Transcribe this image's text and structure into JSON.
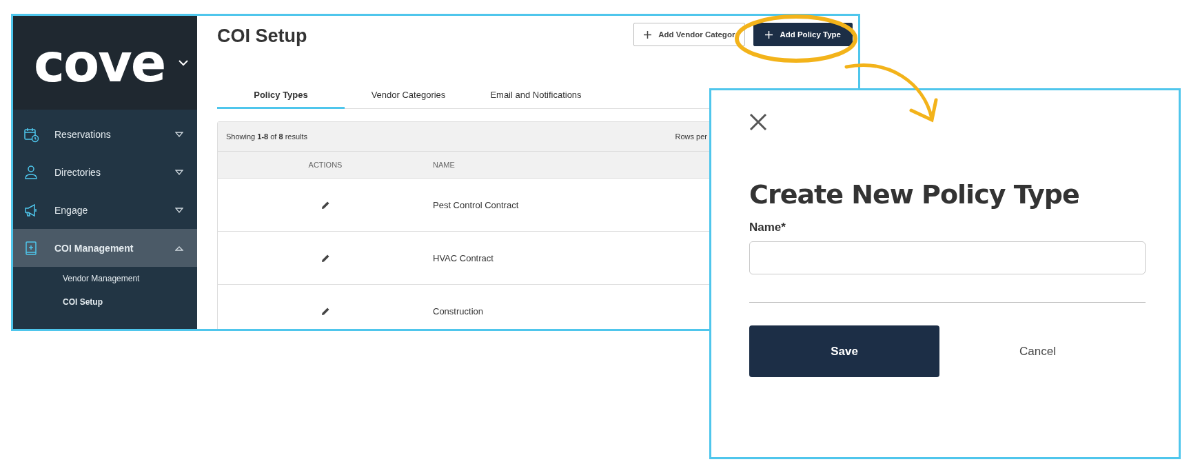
{
  "app_screen": {
    "logo": "cove",
    "sidebar": {
      "items": [
        {
          "kind": "calendar",
          "label": "Reservations",
          "expanded": false,
          "selected": false
        },
        {
          "kind": "person",
          "label": "Directories",
          "expanded": false,
          "selected": false
        },
        {
          "kind": "megaphone",
          "label": "Engage",
          "expanded": false,
          "selected": false
        },
        {
          "kind": "book",
          "label": "COI Management",
          "expanded": true,
          "selected": true,
          "children": [
            {
              "label": "Vendor Management",
              "selected": false
            },
            {
              "label": "COI Setup",
              "selected": true
            }
          ]
        }
      ]
    },
    "page_title": "COI Setup",
    "buttons": [
      {
        "label": "Add Vendor Categor",
        "primary": false
      },
      {
        "label": "Add Policy Type",
        "primary": true
      }
    ],
    "tabs": [
      {
        "label": "Policy Types",
        "selected": true
      },
      {
        "label": "Vendor Categories",
        "selected": false
      },
      {
        "label": "Email and Notifications",
        "selected": false
      }
    ],
    "table": {
      "summary": "Showing **1-8** of **8** results",
      "rows_per_page_label": "Rows per",
      "columns": [
        "ACTIONS",
        "NAME"
      ],
      "rows": [
        {
          "name": "Pest Control Contract"
        },
        {
          "name": "HVAC Contract"
        },
        {
          "name": "Construction"
        }
      ]
    }
  },
  "dialog": {
    "title": "Create New Policy Type",
    "field_label": "Name*",
    "save": "Save",
    "cancel": "Cancel"
  }
}
